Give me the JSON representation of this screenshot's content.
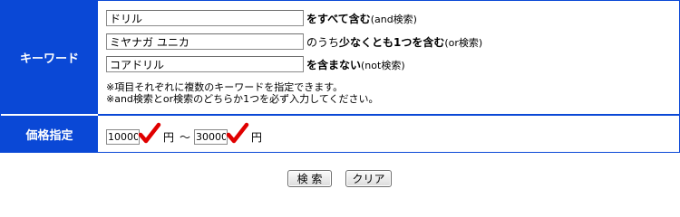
{
  "keyword_section": {
    "label": "キーワード",
    "and_field": {
      "value": "ドリル",
      "desc_bold": "をすべて含む",
      "desc_small": "(and検索)"
    },
    "or_field": {
      "value": "ミヤナガ ユニカ",
      "desc_prefix": "のうち",
      "desc_bold": "少なくとも1つを含む",
      "desc_small": "(or検索)"
    },
    "not_field": {
      "value": "コアドリル",
      "desc_bold": "を含まない",
      "desc_small": "(not検索)"
    },
    "note_line1": "※項目それぞれに複数のキーワードを指定できます。",
    "note_line2": "※and検索とor検索のどちらか1つを必ず入力してください。"
  },
  "price_section": {
    "label": "価格指定",
    "min_value": "10000",
    "max_value": "30000",
    "unit": "円",
    "separator": "～"
  },
  "buttons": {
    "search_label": "検 索",
    "clear_label": "クリア"
  },
  "colors": {
    "header_blue": "#0a48d6",
    "check_red": "#e00000"
  }
}
